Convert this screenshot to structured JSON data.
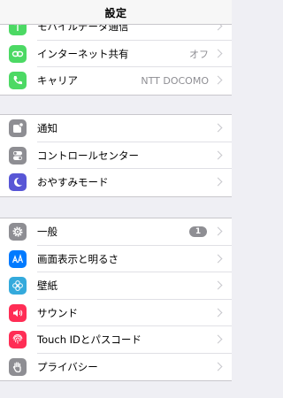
{
  "nav": {
    "title": "設定"
  },
  "groups": [
    {
      "rows": [
        {
          "label": "モバイルデータ通信",
          "icon": "antenna-icon",
          "color": "#4cd964"
        },
        {
          "label": "インターネット共有",
          "value": "オフ",
          "icon": "link-icon",
          "color": "#4cd964"
        },
        {
          "label": "キャリア",
          "value": "NTT DOCOMO",
          "icon": "phone-icon",
          "color": "#4cd964"
        }
      ]
    },
    {
      "rows": [
        {
          "label": "通知",
          "icon": "notifications-icon",
          "color": "#8e8e93"
        },
        {
          "label": "コントロールセンター",
          "icon": "toggles-icon",
          "color": "#8e8e93"
        },
        {
          "label": "おやすみモード",
          "icon": "moon-icon",
          "color": "#5856d6"
        }
      ]
    },
    {
      "rows": [
        {
          "label": "一般",
          "badge": "1",
          "icon": "gear-icon",
          "color": "#8e8e93"
        },
        {
          "label": "画面表示と明るさ",
          "icon": "text-size-icon",
          "color": "#007aff"
        },
        {
          "label": "壁紙",
          "icon": "flower-icon",
          "color": "#34aadc"
        },
        {
          "label": "サウンド",
          "icon": "speaker-icon",
          "color": "#ff2d55"
        },
        {
          "label": "Touch IDとパスコード",
          "icon": "fingerprint-icon",
          "color": "#ff2d55"
        },
        {
          "label": "プライバシー",
          "icon": "hand-icon",
          "color": "#8e8e93"
        }
      ]
    }
  ]
}
